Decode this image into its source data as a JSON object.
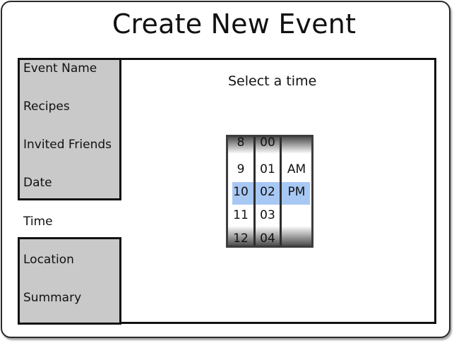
{
  "header": {
    "title": "Create New Event"
  },
  "sidebar": {
    "items": [
      {
        "label": "Event Name",
        "state": "inactive"
      },
      {
        "label": "Recipes",
        "state": "inactive"
      },
      {
        "label": "Invited Friends",
        "state": "inactive"
      },
      {
        "label": "Date",
        "state": "inactive"
      },
      {
        "label": "Time",
        "state": "active"
      },
      {
        "label": "Location",
        "state": "inactive"
      },
      {
        "label": "Summary",
        "state": "inactive"
      }
    ]
  },
  "main": {
    "prompt": "Select a time"
  },
  "time_picker": {
    "hours": [
      "8",
      "9",
      "10",
      "11",
      "12"
    ],
    "minutes": [
      "00",
      "01",
      "02",
      "03",
      "04"
    ],
    "periods": [
      "AM",
      "PM"
    ],
    "selected": {
      "hour": "10",
      "minute": "02",
      "period": "PM"
    },
    "selection_color": "#a8c8f4"
  },
  "colors": {
    "inactive_tab": "#c9c9c9",
    "active_tab": "#ffffff",
    "border": "#111111"
  }
}
